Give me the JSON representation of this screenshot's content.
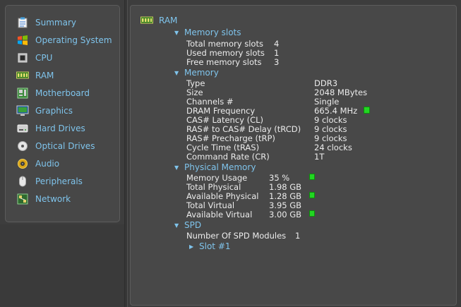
{
  "sidebar": {
    "items": [
      {
        "label": "Summary",
        "icon": "summary-icon"
      },
      {
        "label": "Operating System",
        "icon": "windows-icon"
      },
      {
        "label": "CPU",
        "icon": "cpu-icon"
      },
      {
        "label": "RAM",
        "icon": "ram-icon"
      },
      {
        "label": "Motherboard",
        "icon": "motherboard-icon"
      },
      {
        "label": "Graphics",
        "icon": "monitor-icon"
      },
      {
        "label": "Hard Drives",
        "icon": "hard-drive-icon"
      },
      {
        "label": "Optical Drives",
        "icon": "optical-drive-icon"
      },
      {
        "label": "Audio",
        "icon": "audio-icon"
      },
      {
        "label": "Peripherals",
        "icon": "mouse-icon"
      },
      {
        "label": "Network",
        "icon": "network-icon"
      }
    ]
  },
  "main": {
    "root_label": "RAM",
    "memory_slots": {
      "header": "Memory slots",
      "rows": [
        {
          "label": "Total memory slots",
          "value": "4"
        },
        {
          "label": "Used memory slots",
          "value": "1"
        },
        {
          "label": "Free memory slots",
          "value": "3"
        }
      ]
    },
    "memory": {
      "header": "Memory",
      "rows": [
        {
          "label": "Type",
          "value": "DDR3"
        },
        {
          "label": "Size",
          "value": "2048 MBytes"
        },
        {
          "label": "Channels #",
          "value": "Single"
        },
        {
          "label": "DRAM Frequency",
          "value": "665.4 MHz"
        },
        {
          "label": "CAS# Latency (CL)",
          "value": "9 clocks"
        },
        {
          "label": "RAS# to CAS# Delay (tRCD)",
          "value": "9 clocks"
        },
        {
          "label": "RAS# Precharge (tRP)",
          "value": "9 clocks"
        },
        {
          "label": "Cycle Time (tRAS)",
          "value": "24 clocks"
        },
        {
          "label": "Command Rate (CR)",
          "value": "1T"
        }
      ]
    },
    "physical_memory": {
      "header": "Physical Memory",
      "rows": [
        {
          "label": "Memory Usage",
          "value": "35 %"
        },
        {
          "label": "Total Physical",
          "value": "1.98 GB"
        },
        {
          "label": "Available Physical",
          "value": "1.28 GB"
        },
        {
          "label": "Total Virtual",
          "value": "3.95 GB"
        },
        {
          "label": "Available Virtual",
          "value": "3.00 GB"
        }
      ]
    },
    "spd": {
      "header": "SPD",
      "rows": [
        {
          "label": "Number Of SPD Modules",
          "value": "1"
        }
      ],
      "slot_label": "Slot #1"
    }
  },
  "colors": {
    "accent": "#7fc4ec",
    "indicator": "#22d622"
  }
}
